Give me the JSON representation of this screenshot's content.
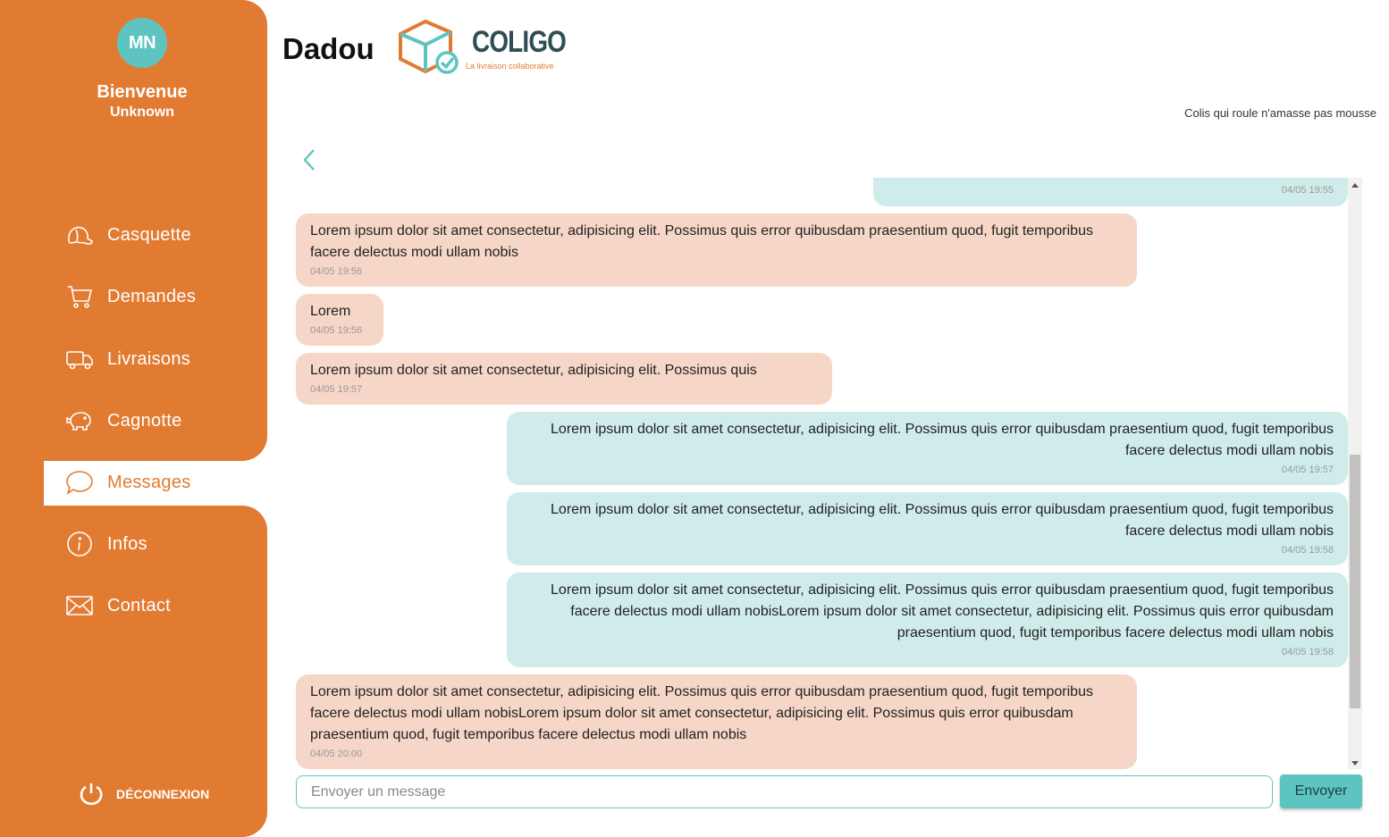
{
  "colors": {
    "brand_orange": "#e27b32",
    "teal": "#5ec4c0",
    "incoming_bubble": "#f6d6c7",
    "outgoing_bubble": "#cfeceb"
  },
  "sidebar": {
    "avatar_initials": "MN",
    "welcome": "Bienvenue",
    "username": "Unknown",
    "items": [
      {
        "label": "Casquette",
        "icon": "cap-icon"
      },
      {
        "label": "Demandes",
        "icon": "cart-icon"
      },
      {
        "label": "Livraisons",
        "icon": "truck-icon"
      },
      {
        "label": "Cagnotte",
        "icon": "piggy-bank-icon"
      },
      {
        "label": "Messages",
        "icon": "chat-bubble-icon",
        "active": true
      },
      {
        "label": "Infos",
        "icon": "info-icon"
      },
      {
        "label": "Contact",
        "icon": "envelope-icon"
      }
    ],
    "logout_label": "DÉCONNEXION"
  },
  "header": {
    "title": "Dadou",
    "logo_word": "COLIGO",
    "logo_tagline": "La livraison collaborative",
    "tagline": "Colis qui roule n'amasse pas mousse"
  },
  "chat": {
    "messages": [
      {
        "dir": "out",
        "text": "",
        "time": "04/05 19:55"
      },
      {
        "dir": "in",
        "text": "Lorem ipsum dolor sit amet consectetur, adipisicing elit. Possimus quis error quibusdam praesentium quod, fugit temporibus facere delectus modi ullam nobis",
        "time": "04/05 19:56"
      },
      {
        "dir": "in",
        "text": "Lorem",
        "time": "04/05 19:56"
      },
      {
        "dir": "in",
        "text": "Lorem ipsum dolor sit amet consectetur, adipisicing elit. Possimus quis",
        "time": "04/05 19:57"
      },
      {
        "dir": "out",
        "text": "Lorem ipsum dolor sit amet consectetur, adipisicing elit. Possimus quis error quibusdam praesentium quod, fugit temporibus facere delectus modi ullam nobis",
        "time": "04/05 19:57"
      },
      {
        "dir": "out",
        "text": "Lorem ipsum dolor sit amet consectetur, adipisicing elit. Possimus quis error quibusdam praesentium quod, fugit temporibus facere delectus modi ullam nobis",
        "time": "04/05 19:58"
      },
      {
        "dir": "out",
        "text": "Lorem ipsum dolor sit amet consectetur, adipisicing elit. Possimus quis error quibusdam praesentium quod, fugit temporibus facere delectus modi ullam nobisLorem ipsum dolor sit amet consectetur, adipisicing elit. Possimus quis error quibusdam praesentium quod, fugit temporibus facere delectus modi ullam nobis",
        "time": "04/05 19:58"
      },
      {
        "dir": "in",
        "text": "Lorem ipsum dolor sit amet consectetur, adipisicing elit. Possimus quis error quibusdam praesentium quod, fugit temporibus facere delectus modi ullam nobisLorem ipsum dolor sit amet consectetur, adipisicing elit. Possimus quis error quibusdam praesentium quod, fugit temporibus facere delectus modi ullam nobis",
        "time": "04/05 20:00"
      }
    ],
    "input_placeholder": "Envoyer un message",
    "send_label": "Envoyer"
  }
}
